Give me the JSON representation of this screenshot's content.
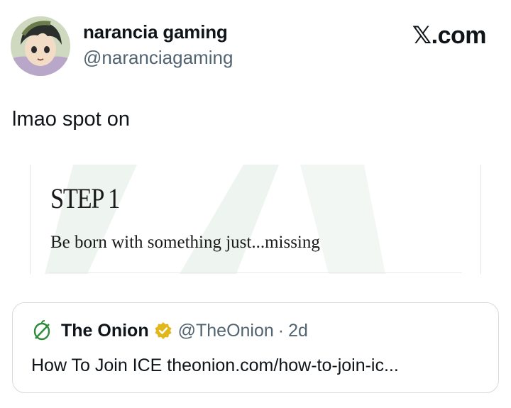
{
  "author": {
    "display_name": "narancia gaming",
    "handle": "@naranciagaming"
  },
  "brand": {
    "glyph": "𝕏",
    "suffix": ".com"
  },
  "tweet": {
    "text": "lmao spot on"
  },
  "media": {
    "step_title": "STEP 1",
    "step_text": "Be born with something just...missing"
  },
  "quoted": {
    "name": "The Onion",
    "handle": "@TheOnion",
    "separator": "·",
    "time": "2d",
    "text": "How To Join ICE theonion.com/how-to-join-ic..."
  },
  "colors": {
    "text_primary": "#0f1419",
    "text_secondary": "#536471",
    "onion_green": "#2e8b3a",
    "verified_gold": "#e2b719"
  },
  "icons": {
    "avatar": "anime-character-avatar",
    "onion": "onion-logo-icon",
    "verified": "verified-badge-icon"
  }
}
